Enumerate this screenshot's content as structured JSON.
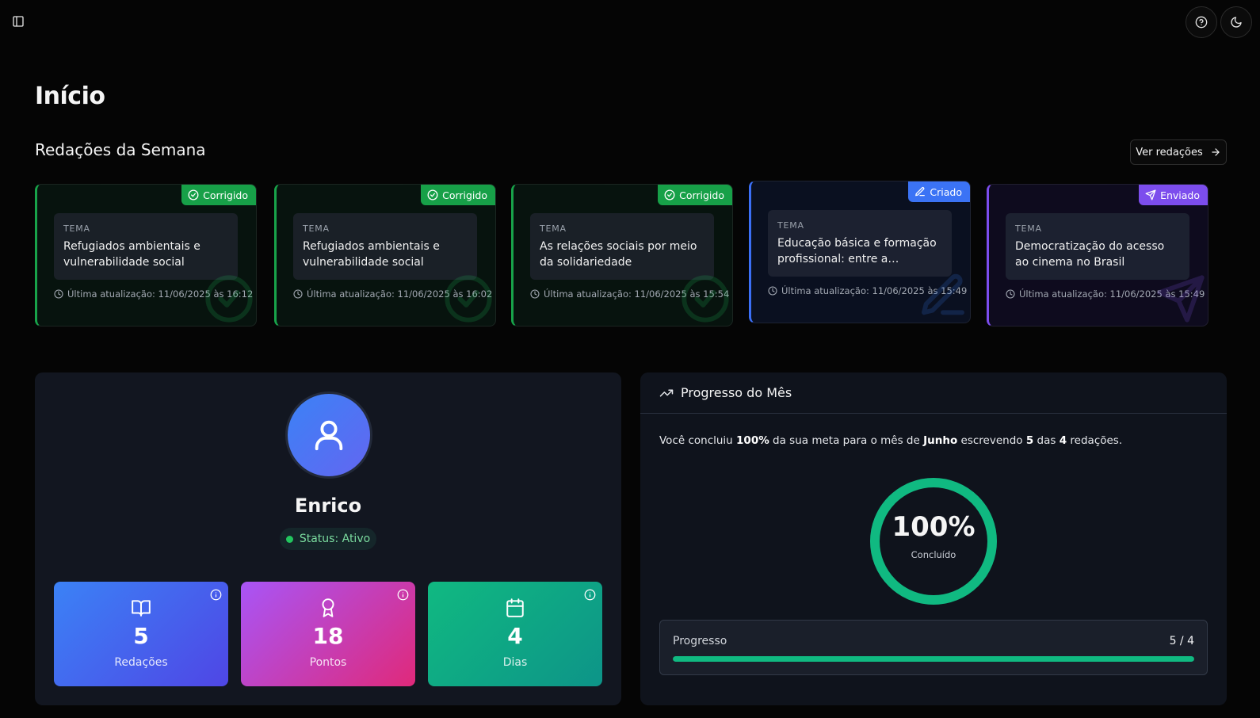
{
  "page": {
    "title": "Início"
  },
  "weekly": {
    "title": "Redações da Semana",
    "see_all_label": "Ver redações",
    "cards": [
      {
        "status": "Corrigido",
        "tema_label": "TEMA",
        "tema": "Refugiados ambientais e vulnerabilidade social",
        "updated": "Última atualização: 11/06/2025 às 16:12"
      },
      {
        "status": "Corrigido",
        "tema_label": "TEMA",
        "tema": "Refugiados ambientais e vulnerabilidade social",
        "updated": "Última atualização: 11/06/2025 às 16:02"
      },
      {
        "status": "Corrigido",
        "tema_label": "TEMA",
        "tema": "As relações sociais por meio da solidariedade",
        "updated": "Última atualização: 11/06/2025 às 15:54"
      },
      {
        "status": "Criado",
        "tema_label": "TEMA",
        "tema": "Educação básica e formação profissional: entre a multitarefa",
        "updated": "Última atualização: 11/06/2025 às 15:49"
      },
      {
        "status": "Enviado",
        "tema_label": "TEMA",
        "tema": "Democratização do acesso ao cinema no Brasil",
        "updated": "Última atualização: 11/06/2025 às 15:49"
      }
    ],
    "colors": {
      "corrigido": "#17a048",
      "criado": "#3b73f5",
      "enviado": "#7c4ded"
    }
  },
  "profile": {
    "name": "Enrico",
    "status": "Status: Ativo",
    "stats": [
      {
        "value": "5",
        "label": "Redações",
        "icon": "book-icon"
      },
      {
        "value": "18",
        "label": "Pontos",
        "icon": "award-icon"
      },
      {
        "value": "4",
        "label": "Dias",
        "icon": "calendar-icon"
      }
    ]
  },
  "progress": {
    "title": "Progresso do Mês",
    "desc": {
      "prefix": "Você concluiu ",
      "percent": "100%",
      "middle1": " da sua meta para o mês de ",
      "month": "Junho",
      "middle2": " escrevendo ",
      "written": "5",
      "middle3": " das ",
      "goal": "4",
      "suffix": " redações."
    },
    "ring_percent": "100%",
    "ring_label": "Concluído",
    "ring_fraction": 1.0,
    "bar_label": "Progresso",
    "bar_value": "5 / 4",
    "bar_fraction": 1.0,
    "accent": "#10b981"
  }
}
